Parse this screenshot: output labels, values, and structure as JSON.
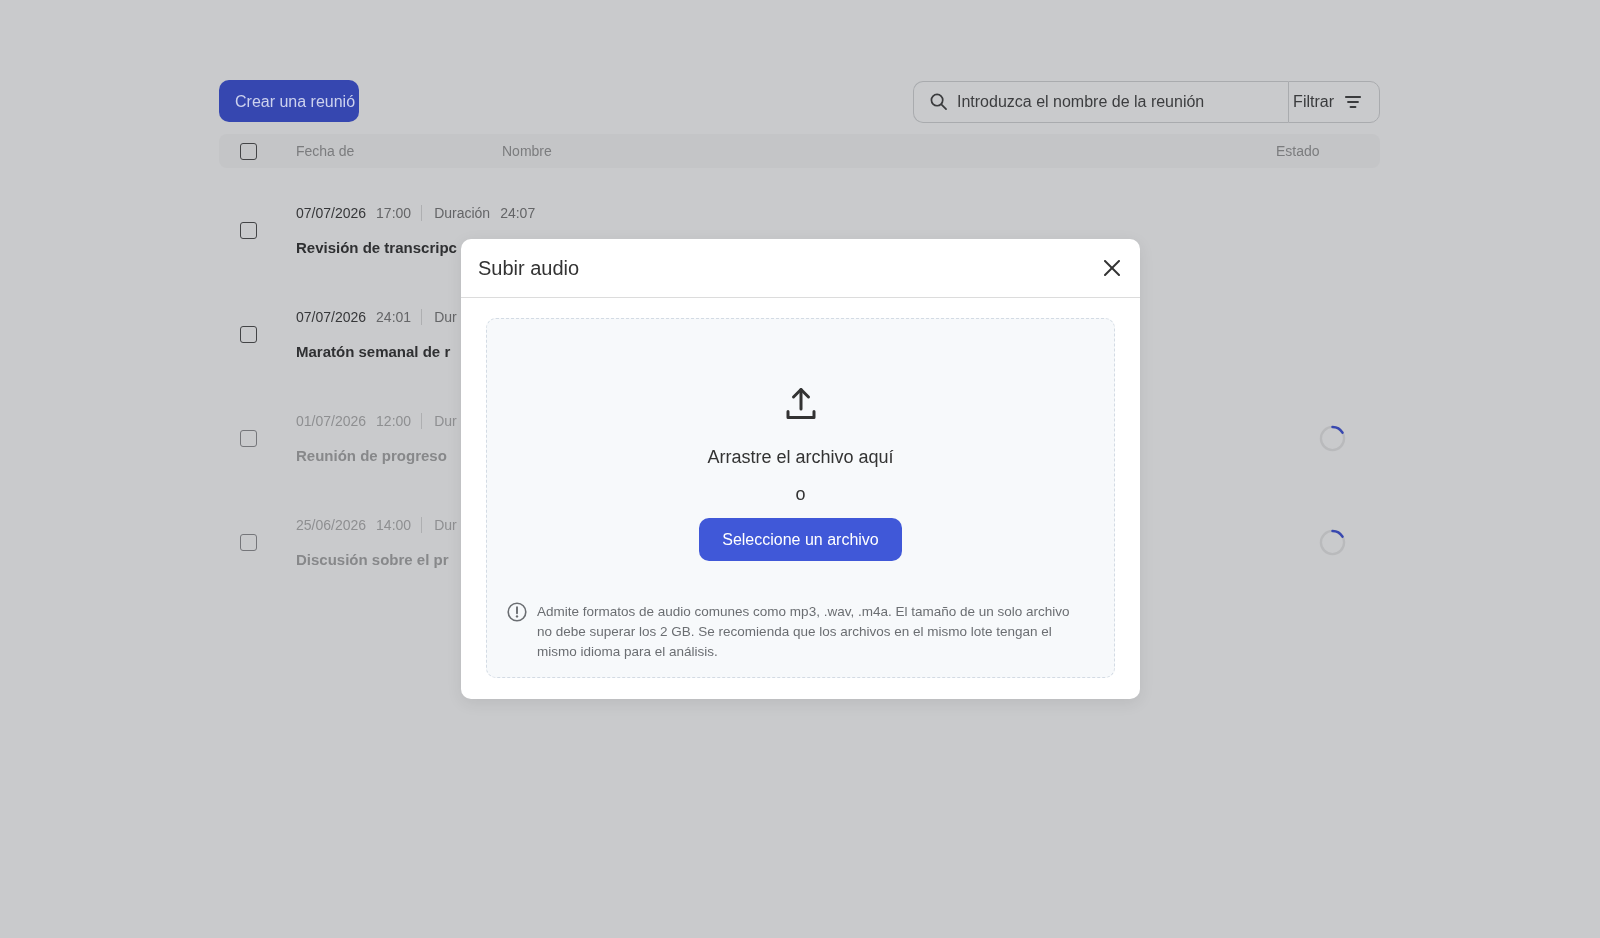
{
  "toolbar": {
    "create_button": {
      "label": "Crear una reunió"
    },
    "search": {
      "placeholder": "Introduzca el nombre de la reunión"
    },
    "filter_button": {
      "label": "Filtrar"
    }
  },
  "table": {
    "select_all": {
      "checked": false
    },
    "columns": [
      "Fecha de",
      "Nombre",
      "Estado"
    ],
    "rows": [
      {
        "checked": false,
        "processing": false,
        "date": "07/07/2026",
        "time": "17:00",
        "duration_label": "Duración",
        "duration": "24:07",
        "title": "Revisión de transcripc"
      },
      {
        "checked": false,
        "processing": false,
        "date": "07/07/2026",
        "time": "24:01",
        "duration_label": "Dur",
        "title": "Maratón semanal de r"
      },
      {
        "checked": false,
        "processing": true,
        "date": "01/07/2026",
        "time": "12:00",
        "duration_label": "Dur",
        "title": "Reunión de progreso"
      },
      {
        "checked": false,
        "processing": true,
        "date": "25/06/2026",
        "time": "14:00",
        "duration_label": "Dur",
        "title": "Discusión sobre el pr"
      }
    ]
  },
  "dialog": {
    "title": "Subir audio",
    "dropzone": {
      "prompt": "Arrastre el archivo aquí",
      "separator": "o",
      "button": "Seleccione un archivo",
      "note": "Admite formatos de audio comunes como mp3, .wav, .m4a. El tamaño de un solo archivo no debe superar los 2 GB. Se recomienda que los archivos en el mismo lote tengan el mismo idioma para el análisis."
    }
  }
}
